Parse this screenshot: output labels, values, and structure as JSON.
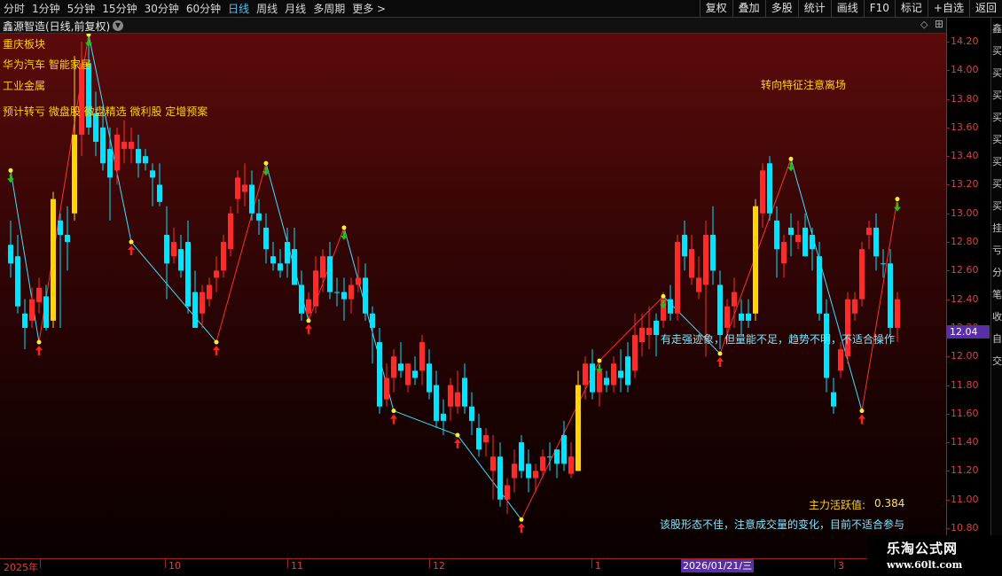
{
  "toolbar": {
    "periods": [
      "分时",
      "1分钟",
      "5分钟",
      "15分钟",
      "30分钟",
      "60分钟",
      "日线",
      "周线",
      "月线",
      "多周期",
      "更多 >"
    ],
    "active_period": "日线",
    "tools": [
      "复权",
      "叠加",
      "多股",
      "统计",
      "画线",
      "F10",
      "标记",
      "+自选",
      "返回"
    ]
  },
  "header": {
    "title": "鑫源智造(日线,前复权)"
  },
  "annotations": {
    "sector": "重庆板块",
    "concepts": "华为汽车 智能家居",
    "industry": "工业金属",
    "tags": "预计转亏 微盘股 微盘精选 微利股 定增预案",
    "turn_signal": "转向特征注意离场",
    "trend_note": "有走强迹象，但量能不足，趋势不明，不适合操作",
    "activity_label": "主力活跃值:",
    "activity_value": "0.384",
    "advice": "该股形态不佳，注意成交量的变化，目前不适合参与"
  },
  "price_axis": {
    "ticks": [
      "14.20",
      "14.00",
      "13.80",
      "13.60",
      "13.40",
      "13.20",
      "13.00",
      "12.80",
      "12.60",
      "12.40",
      "12.20",
      "12.00",
      "11.80",
      "11.60",
      "11.40",
      "11.20",
      "11.00",
      "10.80"
    ],
    "current_price": "12.04"
  },
  "date_axis": {
    "labels": [
      "2025年",
      "10",
      "11",
      "12",
      "1",
      "3"
    ],
    "cursor_date": "2026/01/21/三"
  },
  "side_strip": {
    "chars": [
      "鑫",
      "买",
      "买",
      "买",
      "买",
      "买",
      "买",
      "买",
      "买",
      "挂",
      "亏",
      "分",
      "笔",
      "收",
      "自",
      "交"
    ]
  },
  "watermark": {
    "name": "乐淘公式网",
    "url": "www.60lt.com"
  },
  "colors": {
    "up": "#ff2a2a",
    "down": "#00e5ff",
    "highlight": "#ffd400",
    "buy_arrow": "#ff2020",
    "sell_arrow": "#22c022",
    "zigzag_up": "#ff3030",
    "zigzag_down": "#40e0ff"
  },
  "chart_data": {
    "type": "candlestick",
    "ylim": [
      10.7,
      14.3
    ],
    "candles": [
      {
        "o": 12.78,
        "h": 12.95,
        "l": 12.55,
        "c": 12.65,
        "color": "down"
      },
      {
        "o": 12.7,
        "h": 12.85,
        "l": 12.3,
        "c": 12.35,
        "color": "down"
      },
      {
        "o": 12.3,
        "h": 12.4,
        "l": 12.05,
        "c": 12.2,
        "color": "down"
      },
      {
        "o": 12.25,
        "h": 12.48,
        "l": 12.2,
        "c": 12.4,
        "color": "up"
      },
      {
        "o": 12.38,
        "h": 12.55,
        "l": 12.3,
        "c": 12.48,
        "color": "up"
      },
      {
        "o": 12.42,
        "h": 12.5,
        "l": 12.18,
        "c": 12.2,
        "color": "down"
      },
      {
        "o": 12.25,
        "h": 13.15,
        "l": 12.2,
        "c": 13.1,
        "color": "hl"
      },
      {
        "o": 12.95,
        "h": 13.0,
        "l": 12.2,
        "c": 12.85,
        "color": "down"
      },
      {
        "o": 12.85,
        "h": 13.05,
        "l": 12.6,
        "c": 12.8,
        "color": "down"
      },
      {
        "o": 13.0,
        "h": 14.1,
        "l": 12.95,
        "c": 13.55,
        "color": "hl"
      },
      {
        "o": 13.55,
        "h": 14.2,
        "l": 13.4,
        "c": 14.05,
        "color": "up"
      },
      {
        "o": 14.05,
        "h": 14.18,
        "l": 13.55,
        "c": 13.6,
        "color": "down"
      },
      {
        "o": 13.7,
        "h": 13.85,
        "l": 13.4,
        "c": 13.5,
        "color": "down"
      },
      {
        "o": 13.6,
        "h": 13.75,
        "l": 13.3,
        "c": 13.35,
        "color": "down"
      },
      {
        "o": 13.45,
        "h": 13.6,
        "l": 12.95,
        "c": 13.25,
        "color": "down"
      },
      {
        "o": 13.3,
        "h": 13.6,
        "l": 13.2,
        "c": 13.55,
        "color": "up"
      },
      {
        "o": 13.5,
        "h": 13.65,
        "l": 13.35,
        "c": 13.45,
        "color": "up"
      },
      {
        "o": 13.45,
        "h": 13.6,
        "l": 13.35,
        "c": 13.5,
        "color": "up"
      },
      {
        "o": 13.45,
        "h": 13.55,
        "l": 13.25,
        "c": 13.35,
        "color": "down"
      },
      {
        "o": 13.35,
        "h": 13.45,
        "l": 13.3,
        "c": 13.4,
        "color": "down"
      },
      {
        "o": 13.3,
        "h": 13.35,
        "l": 13.05,
        "c": 13.25,
        "color": "down"
      },
      {
        "o": 13.2,
        "h": 13.35,
        "l": 13.05,
        "c": 13.08,
        "color": "down"
      },
      {
        "o": 12.85,
        "h": 13.05,
        "l": 12.4,
        "c": 12.65,
        "color": "down"
      },
      {
        "o": 12.7,
        "h": 12.9,
        "l": 12.65,
        "c": 12.8,
        "color": "up"
      },
      {
        "o": 12.75,
        "h": 12.85,
        "l": 12.55,
        "c": 12.6,
        "color": "down"
      },
      {
        "o": 12.8,
        "h": 12.95,
        "l": 12.3,
        "c": 12.35,
        "color": "down"
      },
      {
        "o": 12.45,
        "h": 12.6,
        "l": 12.2,
        "c": 12.2,
        "color": "down"
      },
      {
        "o": 12.3,
        "h": 12.5,
        "l": 12.2,
        "c": 12.45,
        "color": "up"
      },
      {
        "o": 12.4,
        "h": 12.55,
        "l": 12.35,
        "c": 12.5,
        "color": "up"
      },
      {
        "o": 12.55,
        "h": 12.7,
        "l": 12.45,
        "c": 12.6,
        "color": "up"
      },
      {
        "o": 12.6,
        "h": 12.85,
        "l": 12.55,
        "c": 12.8,
        "color": "up"
      },
      {
        "o": 12.75,
        "h": 13.05,
        "l": 12.7,
        "c": 13.0,
        "color": "up"
      },
      {
        "o": 13.1,
        "h": 13.3,
        "l": 13.0,
        "c": 13.25,
        "color": "up"
      },
      {
        "o": 13.2,
        "h": 13.35,
        "l": 13.05,
        "c": 13.15,
        "color": "up"
      },
      {
        "o": 13.2,
        "h": 13.3,
        "l": 12.95,
        "c": 13.0,
        "color": "down"
      },
      {
        "o": 13.0,
        "h": 13.1,
        "l": 12.85,
        "c": 12.95,
        "color": "down"
      },
      {
        "o": 12.9,
        "h": 13.0,
        "l": 12.65,
        "c": 12.75,
        "color": "down"
      },
      {
        "o": 12.7,
        "h": 12.8,
        "l": 12.6,
        "c": 12.65,
        "color": "down"
      },
      {
        "o": 12.65,
        "h": 12.75,
        "l": 12.55,
        "c": 12.6,
        "color": "down"
      },
      {
        "o": 12.65,
        "h": 12.9,
        "l": 12.55,
        "c": 12.8,
        "color": "down"
      },
      {
        "o": 12.75,
        "h": 12.9,
        "l": 12.55,
        "c": 12.5,
        "color": "down"
      },
      {
        "o": 12.5,
        "h": 12.6,
        "l": 12.25,
        "c": 12.3,
        "color": "down"
      },
      {
        "o": 12.3,
        "h": 12.45,
        "l": 12.25,
        "c": 12.4,
        "color": "up"
      },
      {
        "o": 12.35,
        "h": 12.7,
        "l": 12.3,
        "c": 12.6,
        "color": "up"
      },
      {
        "o": 12.55,
        "h": 12.75,
        "l": 12.45,
        "c": 12.7,
        "color": "up"
      },
      {
        "o": 12.7,
        "h": 12.8,
        "l": 12.4,
        "c": 12.45,
        "color": "down"
      },
      {
        "o": 12.45,
        "h": 12.55,
        "l": 12.35,
        "c": 12.45,
        "color": "down"
      },
      {
        "o": 12.45,
        "h": 12.55,
        "l": 12.25,
        "c": 12.4,
        "color": "down"
      },
      {
        "o": 12.4,
        "h": 12.55,
        "l": 12.3,
        "c": 12.5,
        "color": "up"
      },
      {
        "o": 12.55,
        "h": 12.7,
        "l": 12.45,
        "c": 12.5,
        "color": "up"
      },
      {
        "o": 12.55,
        "h": 12.65,
        "l": 12.25,
        "c": 12.3,
        "color": "down"
      },
      {
        "o": 12.3,
        "h": 12.35,
        "l": 11.95,
        "c": 12.2,
        "color": "down"
      },
      {
        "o": 12.1,
        "h": 12.2,
        "l": 11.6,
        "c": 11.65,
        "color": "down"
      },
      {
        "o": 11.7,
        "h": 11.95,
        "l": 11.65,
        "c": 11.85,
        "color": "up"
      },
      {
        "o": 11.85,
        "h": 12.05,
        "l": 11.75,
        "c": 12.0,
        "color": "up"
      },
      {
        "o": 11.95,
        "h": 12.1,
        "l": 11.85,
        "c": 11.9,
        "color": "down"
      },
      {
        "o": 11.8,
        "h": 11.95,
        "l": 11.75,
        "c": 11.95,
        "color": "up"
      },
      {
        "o": 11.9,
        "h": 12.0,
        "l": 11.8,
        "c": 11.85,
        "color": "down"
      },
      {
        "o": 11.9,
        "h": 12.15,
        "l": 11.8,
        "c": 12.1,
        "color": "up"
      },
      {
        "o": 11.95,
        "h": 12.05,
        "l": 11.7,
        "c": 11.75,
        "color": "down"
      },
      {
        "o": 11.8,
        "h": 11.9,
        "l": 11.5,
        "c": 11.55,
        "color": "down"
      },
      {
        "o": 11.55,
        "h": 11.7,
        "l": 11.45,
        "c": 11.6,
        "color": "down"
      },
      {
        "o": 11.65,
        "h": 11.85,
        "l": 11.55,
        "c": 11.8,
        "color": "up"
      },
      {
        "o": 11.75,
        "h": 11.9,
        "l": 11.6,
        "c": 11.65,
        "color": "up"
      },
      {
        "o": 11.85,
        "h": 11.95,
        "l": 11.6,
        "c": 11.65,
        "color": "down"
      },
      {
        "o": 11.65,
        "h": 11.75,
        "l": 11.45,
        "c": 11.55,
        "color": "down"
      },
      {
        "o": 11.5,
        "h": 11.6,
        "l": 11.3,
        "c": 11.35,
        "color": "down"
      },
      {
        "o": 11.4,
        "h": 11.5,
        "l": 11.3,
        "c": 11.45,
        "color": "up"
      },
      {
        "o": 11.3,
        "h": 11.45,
        "l": 11.0,
        "c": 11.2,
        "color": "up"
      },
      {
        "o": 11.3,
        "h": 11.4,
        "l": 10.95,
        "c": 11.0,
        "color": "down"
      },
      {
        "o": 11.0,
        "h": 11.15,
        "l": 10.9,
        "c": 11.1,
        "color": "up"
      },
      {
        "o": 11.15,
        "h": 11.35,
        "l": 11.05,
        "c": 11.25,
        "color": "up"
      },
      {
        "o": 11.2,
        "h": 11.45,
        "l": 11.15,
        "c": 11.4,
        "color": "down"
      },
      {
        "o": 11.25,
        "h": 11.35,
        "l": 11.05,
        "c": 11.15,
        "color": "down"
      },
      {
        "o": 11.15,
        "h": 11.25,
        "l": 11.05,
        "c": 11.2,
        "color": "up"
      },
      {
        "o": 11.2,
        "h": 11.35,
        "l": 11.15,
        "c": 11.3,
        "color": "up"
      },
      {
        "o": 11.3,
        "h": 11.4,
        "l": 11.2,
        "c": 11.3,
        "color": "down"
      },
      {
        "o": 11.25,
        "h": 11.35,
        "l": 11.15,
        "c": 11.35,
        "color": "down"
      },
      {
        "o": 11.45,
        "h": 11.55,
        "l": 11.2,
        "c": 11.25,
        "color": "down"
      },
      {
        "o": 11.3,
        "h": 11.4,
        "l": 11.15,
        "c": 11.18,
        "color": "up"
      },
      {
        "o": 11.2,
        "h": 11.9,
        "l": 11.2,
        "c": 11.8,
        "color": "hl"
      },
      {
        "o": 11.8,
        "h": 12.0,
        "l": 11.7,
        "c": 11.95,
        "color": "up"
      },
      {
        "o": 11.95,
        "h": 12.05,
        "l": 11.7,
        "c": 11.75,
        "color": "down"
      },
      {
        "o": 11.75,
        "h": 11.95,
        "l": 11.65,
        "c": 11.9,
        "color": "up"
      },
      {
        "o": 11.85,
        "h": 11.9,
        "l": 11.75,
        "c": 11.8,
        "color": "down"
      },
      {
        "o": 11.8,
        "h": 12.0,
        "l": 11.75,
        "c": 11.95,
        "color": "up"
      },
      {
        "o": 11.9,
        "h": 12.05,
        "l": 11.75,
        "c": 11.85,
        "color": "down"
      },
      {
        "o": 11.8,
        "h": 12.1,
        "l": 11.75,
        "c": 12.0,
        "color": "down"
      },
      {
        "o": 11.9,
        "h": 12.3,
        "l": 11.85,
        "c": 12.15,
        "color": "up"
      },
      {
        "o": 12.1,
        "h": 12.3,
        "l": 12.0,
        "c": 12.2,
        "color": "up"
      },
      {
        "o": 12.2,
        "h": 12.35,
        "l": 12.05,
        "c": 12.15,
        "color": "up"
      },
      {
        "o": 12.15,
        "h": 12.3,
        "l": 12.0,
        "c": 12.25,
        "color": "down"
      },
      {
        "o": 12.25,
        "h": 12.45,
        "l": 12.2,
        "c": 12.4,
        "color": "up"
      },
      {
        "o": 12.4,
        "h": 12.5,
        "l": 12.25,
        "c": 12.3,
        "color": "down"
      },
      {
        "o": 12.3,
        "h": 12.85,
        "l": 12.25,
        "c": 12.8,
        "color": "up"
      },
      {
        "o": 12.7,
        "h": 12.95,
        "l": 12.6,
        "c": 12.85,
        "color": "down"
      },
      {
        "o": 12.75,
        "h": 12.85,
        "l": 12.5,
        "c": 12.55,
        "color": "up"
      },
      {
        "o": 12.55,
        "h": 12.7,
        "l": 12.4,
        "c": 12.45,
        "color": "up"
      },
      {
        "o": 12.5,
        "h": 12.95,
        "l": 12.0,
        "c": 12.85,
        "color": "up"
      },
      {
        "o": 12.85,
        "h": 13.05,
        "l": 12.5,
        "c": 12.6,
        "color": "down"
      },
      {
        "o": 12.5,
        "h": 12.6,
        "l": 12.05,
        "c": 12.15,
        "color": "down"
      },
      {
        "o": 12.2,
        "h": 12.4,
        "l": 12.1,
        "c": 12.35,
        "color": "up"
      },
      {
        "o": 12.35,
        "h": 12.55,
        "l": 12.2,
        "c": 12.45,
        "color": "up"
      },
      {
        "o": 12.3,
        "h": 12.4,
        "l": 12.15,
        "c": 12.25,
        "color": "down"
      },
      {
        "o": 12.25,
        "h": 12.4,
        "l": 12.2,
        "c": 12.3,
        "color": "down"
      },
      {
        "o": 12.3,
        "h": 13.1,
        "l": 12.25,
        "c": 13.05,
        "color": "hl"
      },
      {
        "o": 13.0,
        "h": 13.35,
        "l": 12.9,
        "c": 13.3,
        "color": "up"
      },
      {
        "o": 13.35,
        "h": 13.4,
        "l": 12.95,
        "c": 13.0,
        "color": "down"
      },
      {
        "o": 12.95,
        "h": 13.05,
        "l": 12.55,
        "c": 12.75,
        "color": "down"
      },
      {
        "o": 12.65,
        "h": 12.85,
        "l": 12.55,
        "c": 12.8,
        "color": "up"
      },
      {
        "o": 12.85,
        "h": 13.0,
        "l": 12.7,
        "c": 12.9,
        "color": "down"
      },
      {
        "o": 12.85,
        "h": 12.95,
        "l": 12.75,
        "c": 12.8,
        "color": "up"
      },
      {
        "o": 12.9,
        "h": 13.0,
        "l": 12.7,
        "c": 12.7,
        "color": "down"
      },
      {
        "o": 12.75,
        "h": 12.9,
        "l": 12.6,
        "c": 12.85,
        "color": "down"
      },
      {
        "o": 12.7,
        "h": 12.8,
        "l": 12.25,
        "c": 12.3,
        "color": "down"
      },
      {
        "o": 12.3,
        "h": 12.4,
        "l": 11.75,
        "c": 11.85,
        "color": "down"
      },
      {
        "o": 11.75,
        "h": 11.85,
        "l": 11.6,
        "c": 11.65,
        "color": "down"
      },
      {
        "o": 11.9,
        "h": 12.1,
        "l": 11.85,
        "c": 12.05,
        "color": "up"
      },
      {
        "o": 12.0,
        "h": 12.45,
        "l": 11.95,
        "c": 12.4,
        "color": "up"
      },
      {
        "o": 12.3,
        "h": 12.45,
        "l": 12.25,
        "c": 12.4,
        "color": "up"
      },
      {
        "o": 12.4,
        "h": 12.8,
        "l": 12.35,
        "c": 12.75,
        "color": "up"
      },
      {
        "o": 12.85,
        "h": 12.95,
        "l": 12.75,
        "c": 12.9,
        "color": "up"
      },
      {
        "o": 12.9,
        "h": 13.0,
        "l": 12.6,
        "c": 12.7,
        "color": "down"
      },
      {
        "o": 12.65,
        "h": 12.75,
        "l": 12.55,
        "c": 12.65,
        "color": "down"
      },
      {
        "o": 12.65,
        "h": 12.75,
        "l": 12.15,
        "c": 12.2,
        "color": "down"
      },
      {
        "o": 12.2,
        "h": 12.45,
        "l": 12.1,
        "c": 12.4,
        "color": "up"
      }
    ]
  }
}
